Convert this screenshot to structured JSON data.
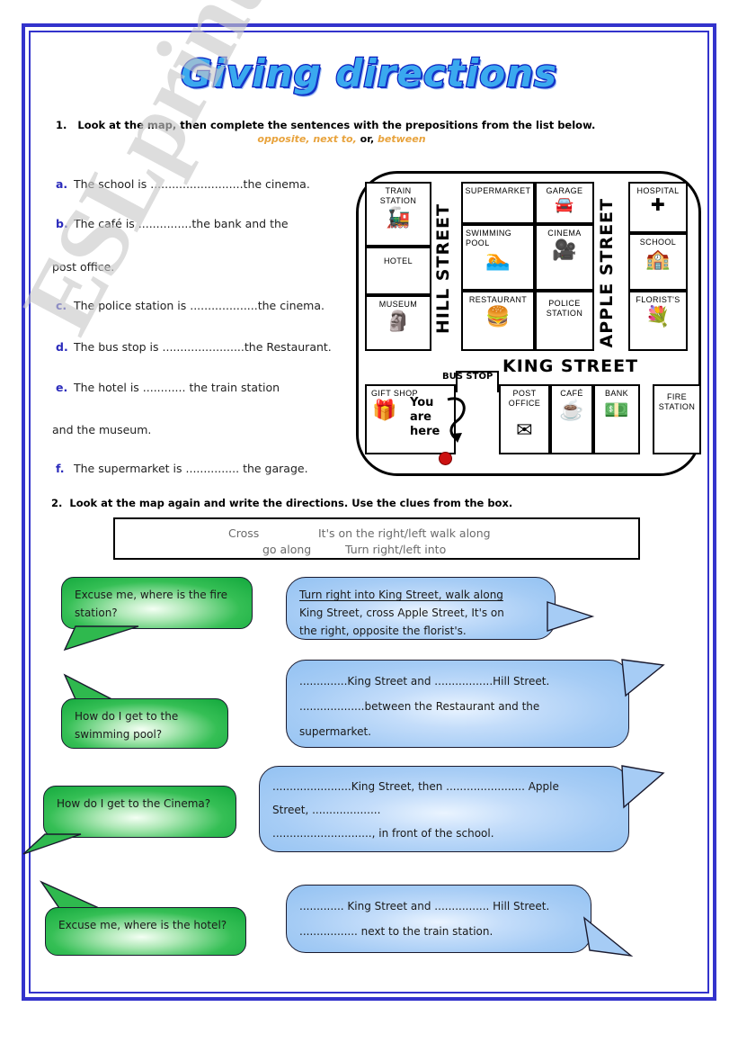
{
  "page": {
    "title": "Giving directions",
    "border_color": "#3333cc",
    "watermark": "ESLprintables.com"
  },
  "task1": {
    "number": "1.",
    "instruction": "Look at the map, then complete the sentences with the prepositions from the list below.",
    "prepositions_prefix": "opposite, next to,",
    "prepositions_or": "or,",
    "prepositions_suffix": "between",
    "sentences": [
      {
        "letter": "a.",
        "text": "The school is ..........................the cinema.",
        "cont": ""
      },
      {
        "letter": "b.",
        "text": "The café is ...............the bank and the",
        "cont": "post office."
      },
      {
        "letter": "c.",
        "text": "The police station is ...................the cinema.",
        "cont": ""
      },
      {
        "letter": "d.",
        "text": "The bus stop is .......................the Restaurant.",
        "cont": ""
      },
      {
        "letter": "e.",
        "text": "The hotel is ............ the train station",
        "cont": "and the museum."
      },
      {
        "letter": "f.",
        "text": "The supermarket is ............... the garage.",
        "cont": ""
      }
    ]
  },
  "map": {
    "streets": {
      "hill": "HILL STREET",
      "apple": "APPLE STREET",
      "king": "KING STREET"
    },
    "blocks": [
      {
        "name": "TRAIN STATION",
        "icon": "train-icon",
        "glyph": "🚂"
      },
      {
        "name": "HOTEL",
        "icon": "",
        "glyph": ""
      },
      {
        "name": "MUSEUM",
        "icon": "bust-icon",
        "glyph": "🗿"
      },
      {
        "name": "SUPERMARKET",
        "icon": "",
        "glyph": ""
      },
      {
        "name": "SWIMMING POOL",
        "icon": "swimmer-icon",
        "glyph": "🏊"
      },
      {
        "name": "RESTAURANT",
        "icon": "meal-icon",
        "glyph": "🍔"
      },
      {
        "name": "GARAGE",
        "icon": "car-icon",
        "glyph": "🚘"
      },
      {
        "name": "CINEMA",
        "icon": "film-projector-icon",
        "glyph": "🎥"
      },
      {
        "name": "POLICE STATION",
        "icon": "",
        "glyph": ""
      },
      {
        "name": "HOSPITAL",
        "icon": "cross-icon",
        "glyph": "✚"
      },
      {
        "name": "SCHOOL",
        "icon": "school-icon",
        "glyph": "🏫"
      },
      {
        "name": "FLORIST'S",
        "icon": "flower-icon",
        "glyph": "💐"
      },
      {
        "name": "GIFT  SHOP",
        "icon": "gift-icon",
        "glyph": "🎁"
      },
      {
        "name": "POST OFFICE",
        "icon": "envelope-icon",
        "glyph": "✉"
      },
      {
        "name": "CAFÉ",
        "icon": "coffee-cup-icon",
        "glyph": "☕"
      },
      {
        "name": "BANK",
        "icon": "banknote-icon",
        "glyph": "💵"
      },
      {
        "name": "FIRE STATION",
        "icon": "",
        "glyph": ""
      }
    ],
    "bus_stop_label": "BUS STOP",
    "you_are_here": "You\nare\nhere",
    "you_are_here_lines": [
      "You",
      "are",
      "here"
    ]
  },
  "task2": {
    "number": "2.",
    "instruction": "Look at the map again and write the directions. Use the clues from the box.",
    "clues_line1": [
      "Cross",
      "It's on the right/left  walk along"
    ],
    "clues_line2": [
      "go along",
      "Turn right/left into"
    ]
  },
  "dialogues": [
    {
      "question": "Excuse me, where is the fire station?",
      "answer_lines": [
        "Turn right into King Street, walk along",
        "King Street, cross Apple Street, It's on",
        "the right, opposite the florist's."
      ]
    },
    {
      "question": "How do I get to the swimming pool?",
      "answer_lines": [
        "..............King Street and .................Hill Street.",
        "...................between the Restaurant and the",
        "supermarket."
      ]
    },
    {
      "question": "How do I get to the Cinema?",
      "answer_lines": [
        ".......................King Street, then ....................... Apple",
        "Street, ....................",
        "............................., in front of the school."
      ]
    },
    {
      "question": "Excuse me, where is the hotel?",
      "answer_lines": [
        "............. King Street and ................ Hill Street.",
        "................. next to the train station."
      ]
    }
  ]
}
